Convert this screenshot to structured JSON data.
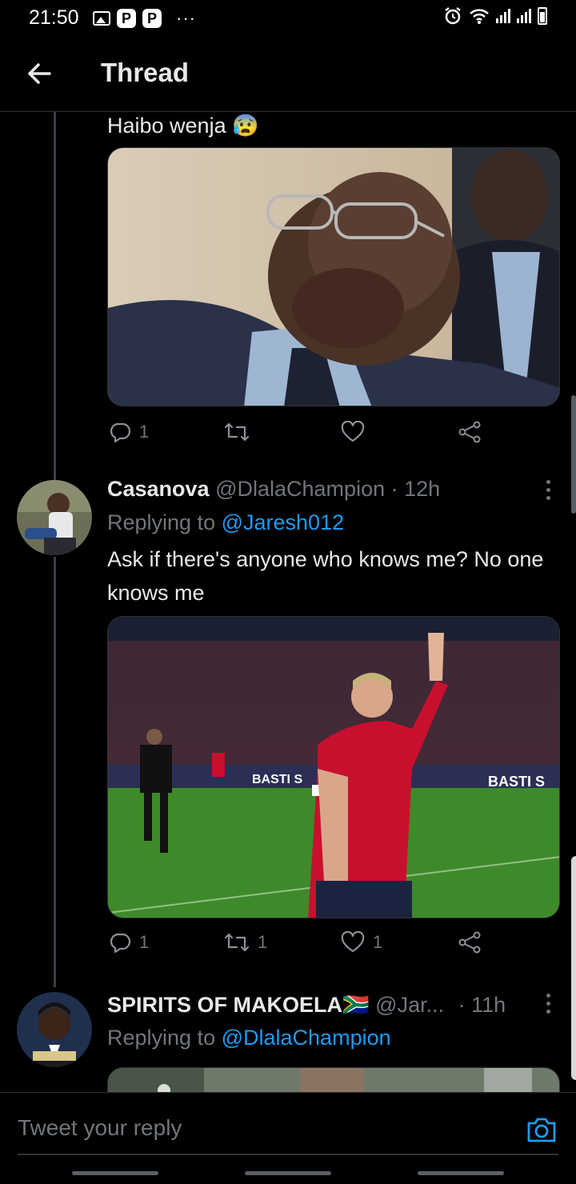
{
  "status_bar": {
    "time": "21:50",
    "notif_p1": "P",
    "notif_p2": "P",
    "more": "···"
  },
  "header": {
    "title": "Thread"
  },
  "tweet1": {
    "text": "Haibo wenja 😰",
    "reply_count": "1",
    "retweet_count": "",
    "like_count": ""
  },
  "tweet2": {
    "name": "Casanova",
    "handle": "@DlalaChampion",
    "separator": "·",
    "time": "12h",
    "replying_prefix": "Replying to",
    "replying_to": "@Jaresh012",
    "text": "Ask if there's anyone who knows me? No one knows me",
    "image_banner_1": "BASTI S",
    "image_banner_2": "BASTI S",
    "reply_count": "1",
    "retweet_count": "1",
    "like_count": "1"
  },
  "tweet3": {
    "name": "SPIRITS OF MAKOELA",
    "flag": "🇿🇦",
    "handle": "@Jar...",
    "separator": "·",
    "time": "11h",
    "replying_prefix": "Replying to",
    "replying_to": "@DlalaChampion"
  },
  "reply_bar": {
    "placeholder": "Tweet your reply"
  },
  "colors": {
    "accent": "#1d9bf0",
    "muted": "#71767b",
    "background": "#000000"
  }
}
